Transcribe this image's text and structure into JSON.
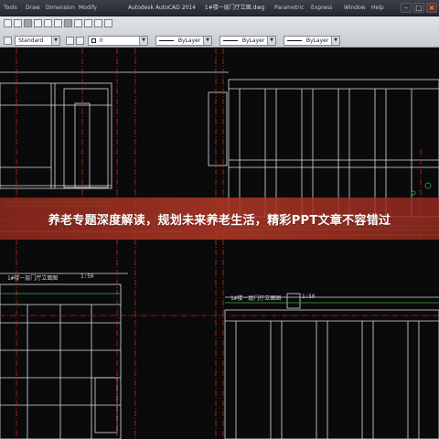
{
  "window": {
    "title": "Autodesk AutoCAD 2014",
    "drawing_name": "1#楼一层门厅立面.dwg",
    "menu": [
      "Tools",
      "Draw",
      "Dimension",
      "Modify",
      "Parametric",
      "Express",
      "Window",
      "Help"
    ]
  },
  "toolbar": {
    "style_value": "Standard",
    "layer_value": "0",
    "color_value": "ByLayer",
    "linetype_value": "ByLayer",
    "lineweight_value": "ByLayer"
  },
  "drawing": {
    "label_left": "1#楼一层门厅立面图",
    "label_left_scale": "1:50",
    "label_right": "1#楼一层门厅立面图",
    "label_right_scale": "1:50"
  },
  "banner": {
    "text": "养老专题深度解读，规划未来养老生活，精彩PPT文章不容错过"
  },
  "colors": {
    "banner": "#a8361f",
    "line_white": "#d9dde3",
    "line_red": "#c2291e",
    "line_green": "#3aa845",
    "background": "#0a0a0b"
  }
}
